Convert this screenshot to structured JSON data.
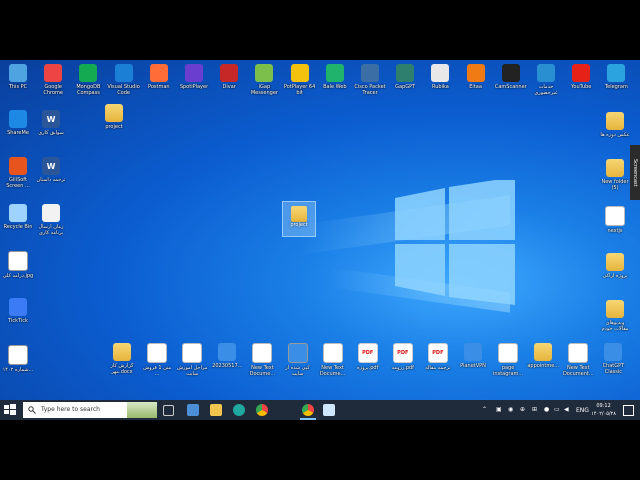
{
  "desktop": {
    "top_row": [
      {
        "label": "This PC",
        "icon": "computer-icon",
        "color": "#4fa3e0"
      },
      {
        "label": "Google Chrome",
        "icon": "chrome-icon",
        "color": "#e44"
      },
      {
        "label": "MongoDB Compass",
        "icon": "mongodb-icon",
        "color": "#13aa52"
      },
      {
        "label": "Visual Studio Code",
        "icon": "vscode-icon",
        "color": "#1b7fd6"
      },
      {
        "label": "Postman",
        "icon": "postman-icon",
        "color": "#ff6c37"
      },
      {
        "label": "SpotiPlayer",
        "icon": "shield-icon",
        "color": "#6a3fd0"
      },
      {
        "label": "Divar",
        "icon": "divar-icon",
        "color": "#c62828"
      },
      {
        "label": "iGap Messenger",
        "icon": "igap-icon",
        "color": "#7cc04b"
      },
      {
        "label": "PotPlayer 64 bit",
        "icon": "potplayer-icon",
        "color": "#f4c20d"
      },
      {
        "label": "Bale Web",
        "icon": "bale-icon",
        "color": "#20b36b"
      },
      {
        "label": "Cisco Packet Tracer",
        "icon": "packet-tracer-icon",
        "color": "#3a6ea5"
      },
      {
        "label": "GapGPT",
        "icon": "gapgpt-icon",
        "color": "#2f7f6f"
      },
      {
        "label": "Rubika",
        "icon": "rubika-icon",
        "color": "#e8e8e8"
      },
      {
        "label": "Eitaa",
        "icon": "eitaa-icon",
        "color": "#f07a14"
      },
      {
        "label": "CamScanner",
        "icon": "camscanner-icon",
        "color": "#222"
      },
      {
        "label": "خدمات غیرحضوری",
        "icon": "service-icon",
        "color": "#2a8fd0"
      },
      {
        "label": "YouTube",
        "icon": "youtube-icon",
        "color": "#e62117"
      },
      {
        "label": "Telegram",
        "icon": "telegram-icon",
        "color": "#2aa3df"
      }
    ],
    "left_column": [
      {
        "label": "ShareMe",
        "icon": "share-icon",
        "color": "#1e88e5"
      },
      {
        "label": "GiliSoft Screen ...",
        "icon": "recorder-icon",
        "color": "#e8541e"
      },
      {
        "label": "Recycle Bin",
        "icon": "recycle-bin-icon",
        "color": "#9fd3ff"
      },
      {
        "label": "درآمد کلی.jpg",
        "icon": "image-icon",
        "color": "#ffffff"
      },
      {
        "label": "TickTick",
        "icon": "ticktick-icon",
        "color": "#3b7cf6"
      },
      {
        "label": "شماره ۱۴۰۲...",
        "icon": "image-icon",
        "color": "#ffffff"
      }
    ],
    "col2": [
      {
        "label": "سوابق کاری",
        "icon": "word-icon",
        "color": "#2b579a"
      },
      {
        "label": "ترجمه داستان",
        "icon": "word-icon",
        "color": "#2b579a"
      },
      {
        "label": "زمان ارسال برنامه کاری",
        "icon": "shortcut-icon",
        "color": "#f2f2f2"
      }
    ],
    "small_folder": {
      "label": "project",
      "icon": "folder-icon"
    },
    "selected_folder": {
      "label": "project",
      "icon": "folder-icon"
    },
    "right_column": [
      {
        "label": "عکس دوره ها",
        "icon": "folder-icon"
      },
      {
        "label": "New folder (5)",
        "icon": "folder-icon"
      },
      {
        "label": "nextjs",
        "icon": "doc-icon"
      },
      {
        "label": "پروژه اراکی",
        "icon": "folder-icon"
      },
      {
        "label": "ویدیوهای مقالات خودم",
        "icon": "folder-icon"
      }
    ],
    "bottom_row": [
      {
        "label": "گزارش کار مهر.docx",
        "icon": "folder-icon"
      },
      {
        "label": "متن 1 فروش ...",
        "icon": "doc-icon"
      },
      {
        "label": "مراحل آموزش سایت",
        "icon": "doc-icon"
      },
      {
        "label": "20230517...",
        "icon": "mp3-icon"
      },
      {
        "label": "New Text Docume...",
        "icon": "doc-icon"
      },
      {
        "label": "کپی شده از سایت",
        "icon": "image-icon"
      },
      {
        "label": "New Text Docume...",
        "icon": "doc-icon"
      },
      {
        "label": "پروژه.pdf",
        "icon": "pdf-icon"
      },
      {
        "label": "رزومه.pdf",
        "icon": "pdf-icon"
      },
      {
        "label": "ترجمه مقاله",
        "icon": "pdf-icon"
      },
      {
        "label": "PlanetVPN",
        "icon": "vpn-icon"
      },
      {
        "label": "page instagram...",
        "icon": "doc-icon"
      },
      {
        "label": "appointme...",
        "icon": "folder-icon"
      },
      {
        "label": "New Text Document...",
        "icon": "doc-icon"
      },
      {
        "label": "ChatGPT Classic",
        "icon": "chatgpt-icon"
      }
    ],
    "screencast_tab": "Screencast"
  },
  "taskbar": {
    "search_placeholder": "Type here to search",
    "lang": "ENG",
    "time": "09:12",
    "date": "۱۴۰۲/۰۵/۲۸"
  }
}
